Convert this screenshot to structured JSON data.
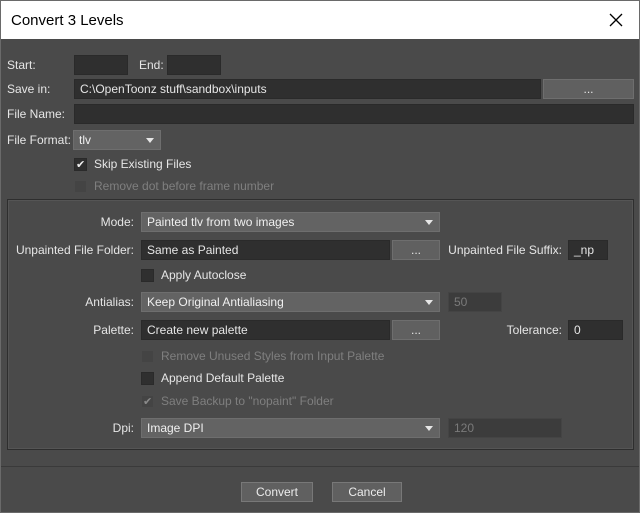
{
  "window": {
    "title": "Convert 3 Levels"
  },
  "range": {
    "start_label": "Start:",
    "start_value": "",
    "end_label": "End:",
    "end_value": ""
  },
  "save_in": {
    "label": "Save in:",
    "value": "C:\\OpenToonz stuff\\sandbox\\inputs",
    "browse_label": "..."
  },
  "file_name": {
    "label": "File Name:",
    "value": ""
  },
  "file_format": {
    "label": "File Format:",
    "selected": "tlv"
  },
  "skip_existing": {
    "label": "Skip Existing Files",
    "checked": true
  },
  "remove_dot": {
    "label": "Remove dot before frame number",
    "checked": false,
    "enabled": false
  },
  "mode": {
    "label": "Mode:",
    "selected": "Painted tlv from two images"
  },
  "unpainted_folder": {
    "label": "Unpainted File Folder:",
    "value": "Same as Painted",
    "browse_label": "..."
  },
  "unpainted_suffix": {
    "label": "Unpainted File Suffix:",
    "value": "_np"
  },
  "apply_autoclose": {
    "label": "Apply Autoclose",
    "checked": false
  },
  "antialias": {
    "label": "Antialias:",
    "selected": "Keep Original Antialiasing",
    "value": "50"
  },
  "palette": {
    "label": "Palette:",
    "value": "Create new palette",
    "browse_label": "..."
  },
  "tolerance": {
    "label": "Tolerance:",
    "value": "0"
  },
  "remove_unused": {
    "label": "Remove Unused Styles from Input Palette",
    "checked": false,
    "enabled": false
  },
  "append_default": {
    "label": "Append Default Palette",
    "checked": false
  },
  "save_backup": {
    "label": "Save Backup to \"nopaint\" Folder",
    "checked": true,
    "enabled": false
  },
  "dpi": {
    "label": "Dpi:",
    "selected": "Image DPI",
    "value": "120"
  },
  "footer": {
    "convert_label": "Convert",
    "cancel_label": "Cancel"
  },
  "colors": {
    "background": "#4a4a4a",
    "field": "#2f2f2f",
    "button": "#606060",
    "titlebar": "#ffffff"
  }
}
